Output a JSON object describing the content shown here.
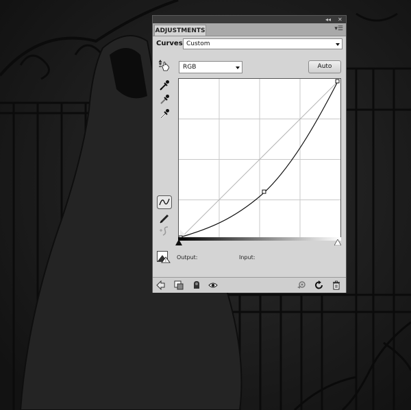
{
  "panel": {
    "tab_label": "ADJUSTMENTS",
    "collapse_glyph": "◂◂",
    "close_glyph": "✕",
    "menu_glyph": "▾☰"
  },
  "curves": {
    "label": "Curves",
    "preset_value": "Custom",
    "channel_value": "RGB",
    "auto_label": "Auto",
    "output_label": "Output:",
    "input_label": "Input:"
  },
  "icons": {
    "on_image_tool": "hand-target-icon",
    "black_point": "eyedropper-black-icon",
    "gray_point": "eyedropper-gray-icon",
    "white_point": "eyedropper-white-icon",
    "curve_mode": "curve-points-icon",
    "pencil_mode": "pencil-icon",
    "smooth": "smooth-curve-icon",
    "clipping_warning": "clipping-warning-icon",
    "back": "back-arrow-icon",
    "expanded_view": "expanded-view-icon",
    "clip_layer": "clip-layer-icon",
    "visibility": "eye-icon",
    "previous_state": "previous-state-icon",
    "reset": "reset-icon",
    "delete": "trash-icon"
  },
  "colors": {
    "panel_bg": "#d4d4d4",
    "panel_bar": "#3a3a3a",
    "tab_row": "#a9a9a9",
    "scene_bg": "#1b1b1b"
  }
}
